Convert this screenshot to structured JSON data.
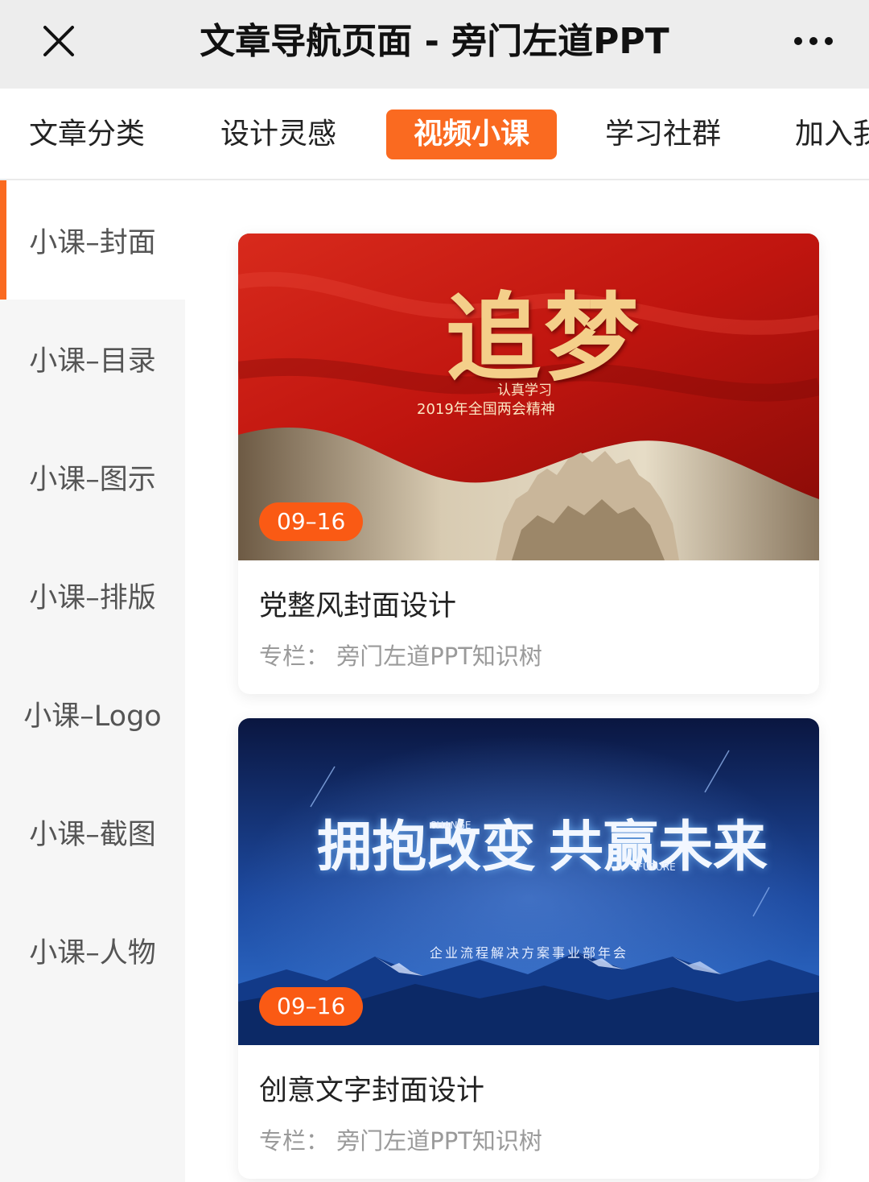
{
  "header": {
    "title": "文章导航页面 - 旁门左道PPT",
    "close_icon": "close-icon",
    "more_icon": "more-horizontal-icon"
  },
  "tabs": [
    {
      "label": "文章分类",
      "active": false
    },
    {
      "label": "设计灵感",
      "active": false
    },
    {
      "label": "视频小课",
      "active": true
    },
    {
      "label": "学习社群",
      "active": false
    },
    {
      "label": "加入我",
      "active": false
    }
  ],
  "sidebar": {
    "items": [
      {
        "label": "小课–封面",
        "active": true
      },
      {
        "label": "小课–目录",
        "active": false
      },
      {
        "label": "小课–图示",
        "active": false
      },
      {
        "label": "小课–排版",
        "active": false
      },
      {
        "label": "小课–Logo",
        "active": false
      },
      {
        "label": "小课–截图",
        "active": false
      },
      {
        "label": "小课–人物",
        "active": false
      }
    ]
  },
  "cards": [
    {
      "date": "09–16",
      "title": "党整风封面设计",
      "meta": "专栏：  旁门左道PPT知识树",
      "cover": {
        "headline": "追梦",
        "line1": "认真学习",
        "line2": "2019年全国两会精神"
      }
    },
    {
      "date": "09–16",
      "title": "创意文字封面设计",
      "meta": "专栏：  旁门左道PPT知识树",
      "cover": {
        "headline_left": "拥抱改变",
        "headline_right": "共赢未来",
        "tag_left": "CHANGE",
        "tag_right": "FUTURE",
        "subline": "企业流程解决方案事业部年会"
      }
    }
  ],
  "colors": {
    "accent": "#fa6a20",
    "badge": "#fa5a14",
    "topbar_bg": "#ededed",
    "sidebar_bg": "#f6f6f6"
  }
}
